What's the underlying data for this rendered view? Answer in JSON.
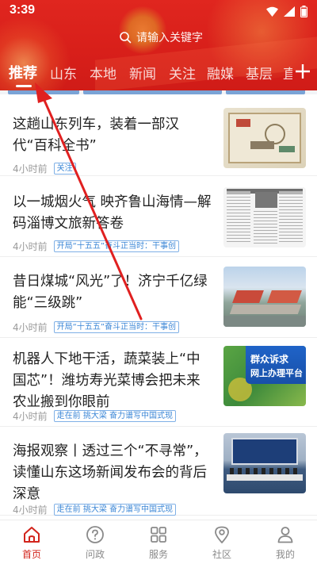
{
  "status": {
    "time": "3:39"
  },
  "search": {
    "placeholder": "请输入关键字"
  },
  "tabs": [
    {
      "label": "推荐"
    },
    {
      "label": "山东"
    },
    {
      "label": "本地"
    },
    {
      "label": "新闻"
    },
    {
      "label": "关注"
    },
    {
      "label": "融媒"
    },
    {
      "label": "基层"
    },
    {
      "label": "直"
    }
  ],
  "news": [
    {
      "title": "这趟山东列车，装着一部汉代“百科全书”",
      "time": "4小时前",
      "tag": "关注"
    },
    {
      "title": "以一城烟火气  映齐鲁山海情—解码淄博文旅新答卷",
      "time": "4小时前",
      "tag": "开局“十五五”奋斗正当时：干事创"
    },
    {
      "title": "昔日煤城“风光”了！济宁千亿绿能“三级跳”",
      "time": "4小时前",
      "tag": "开局“十五五”奋斗正当时：干事创"
    },
    {
      "title": "机器人下地干活，蔬菜装上“中国芯”！潍坊寿光菜博会把未来农业搬到你眼前",
      "time": "4小时前",
      "tag": "走在前  挑大梁  奋力谱写中国式现",
      "thumb_text_1": "群众诉求",
      "thumb_text_2": "网上办理平台"
    },
    {
      "title": "海报观察丨透过三个“不寻常”，读懂山东这场新闻发布会的背后深意",
      "time": "4小时前",
      "tag": "走在前  挑大梁  奋力谱写中国式现"
    }
  ],
  "bottom_nav": [
    {
      "label": "首页",
      "icon": "home-icon",
      "active": true
    },
    {
      "label": "问政",
      "icon": "question-icon",
      "active": false
    },
    {
      "label": "服务",
      "icon": "grid-icon",
      "active": false
    },
    {
      "label": "社区",
      "icon": "location-pin-icon",
      "active": false
    },
    {
      "label": "我的",
      "icon": "person-icon",
      "active": false
    }
  ],
  "colors": {
    "brand_red": "#d81f1a",
    "tag_blue": "#3a86d6",
    "annotation_red": "#e02020"
  }
}
